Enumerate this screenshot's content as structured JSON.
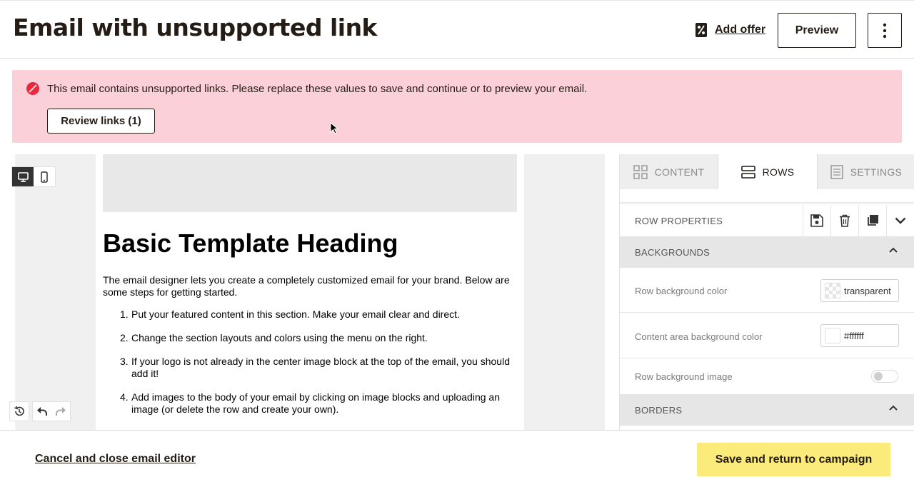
{
  "header": {
    "title": "Email with unsupported link",
    "add_offer_label": "Add offer",
    "preview_label": "Preview",
    "icons": {
      "offer": "percent-tag-icon",
      "more": "more-vertical-icon"
    }
  },
  "alert": {
    "message": "This email contains unsupported links. Please replace these values to save and continue or to preview your email.",
    "review_label": "Review links (1)",
    "color": "#fbd0d8",
    "icon": "prohibited-icon"
  },
  "email": {
    "heading": "Basic Template Heading",
    "intro": "The email designer lets you create a completely customized email for your brand. Below are some steps for getting started.",
    "steps": [
      {
        "num": "1.",
        "text": "Put your featured content in this section. Make your email clear and direct."
      },
      {
        "num": "2.",
        "text": "Change the section layouts and colors using the menu on the right."
      },
      {
        "num": "3.",
        "text": "If your logo is not already in the center image block at the top of the email, you should add it!"
      },
      {
        "num": "4.",
        "text": "Add images to the body of your email by clicking on image blocks and uploading an image (or delete the row and create your own)."
      }
    ]
  },
  "panel": {
    "tabs": [
      {
        "label": "CONTENT",
        "icon": "grid-icon",
        "active": false
      },
      {
        "label": "ROWS",
        "icon": "rows-icon",
        "active": true
      },
      {
        "label": "SETTINGS",
        "icon": "settings-list-icon",
        "active": false
      }
    ],
    "row_properties": "ROW PROPERTIES",
    "backgrounds": "BACKGROUNDS",
    "borders": "BORDERS",
    "props": {
      "row_bg_label": "Row background color",
      "row_bg_value": "transparent",
      "content_bg_label": "Content area background color",
      "content_bg_value": "#ffffff",
      "row_bg_image_label": "Row background image"
    }
  },
  "footer": {
    "cancel_label": "Cancel and close email editor",
    "save_label": "Save and return to campaign",
    "save_color": "#fbeb7a"
  }
}
